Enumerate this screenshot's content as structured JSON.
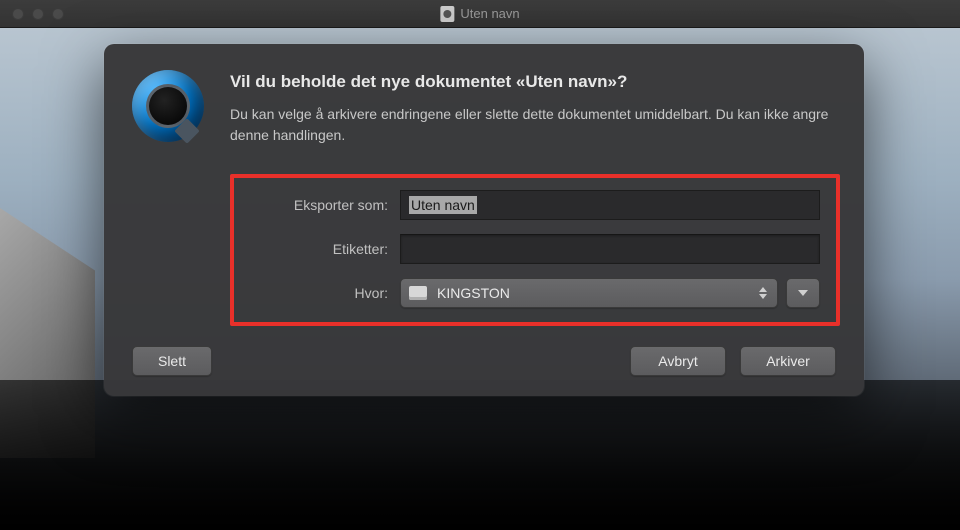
{
  "window": {
    "title": "Uten navn"
  },
  "dialog": {
    "heading": "Vil du beholde det nye dokumentet «Uten navn»?",
    "description": "Du kan velge å arkivere endringene eller slette dette dokumentet umiddelbart. Du kan ikke angre denne handlingen.",
    "form": {
      "export_label": "Eksporter som:",
      "export_value": "Uten navn",
      "tags_label": "Etiketter:",
      "tags_value": "",
      "location_label": "Hvor:",
      "location_value": "KINGSTON"
    },
    "buttons": {
      "delete": "Slett",
      "cancel": "Avbryt",
      "save": "Arkiver"
    }
  }
}
